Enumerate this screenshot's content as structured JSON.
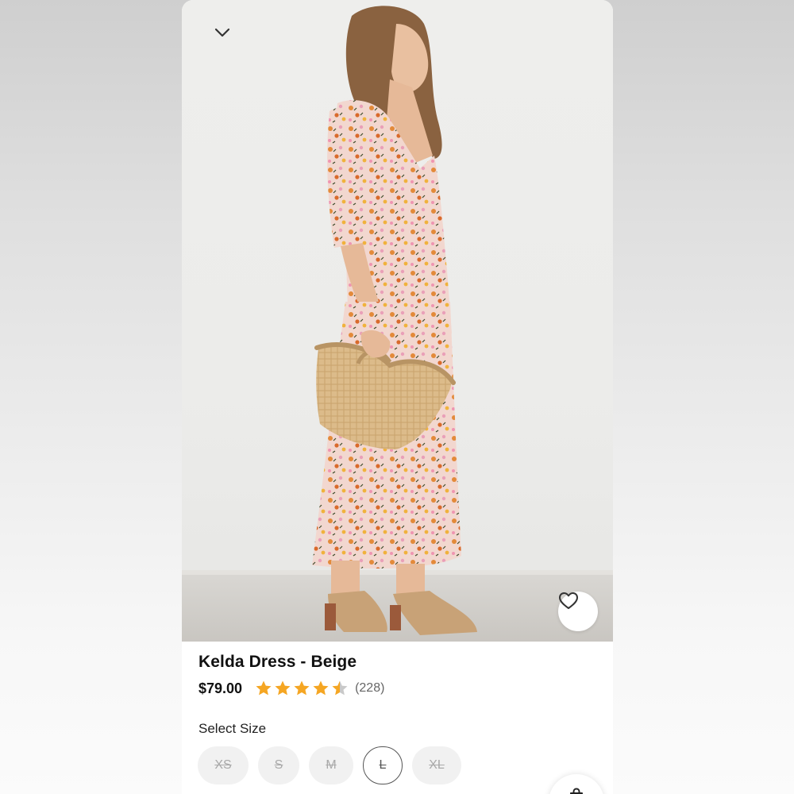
{
  "product": {
    "title": "Kelda Dress - Beige",
    "price": "$79.00",
    "rating": 4.5,
    "rating_max": 5,
    "review_count": "(228)",
    "star_color": "#f5a623",
    "image_icon": "product-photo"
  },
  "header": {
    "collapse_icon": "chevron-down-icon"
  },
  "favorite": {
    "icon": "heart-icon"
  },
  "size_selector": {
    "label": "Select Size",
    "options": [
      {
        "label": "XS",
        "available": false,
        "selected": false
      },
      {
        "label": "S",
        "available": false,
        "selected": false
      },
      {
        "label": "M",
        "available": false,
        "selected": false
      },
      {
        "label": "L",
        "available": false,
        "selected": true
      },
      {
        "label": "XL",
        "available": false,
        "selected": false
      }
    ]
  },
  "bag_button": {
    "icon": "shopping-bag-icon"
  }
}
